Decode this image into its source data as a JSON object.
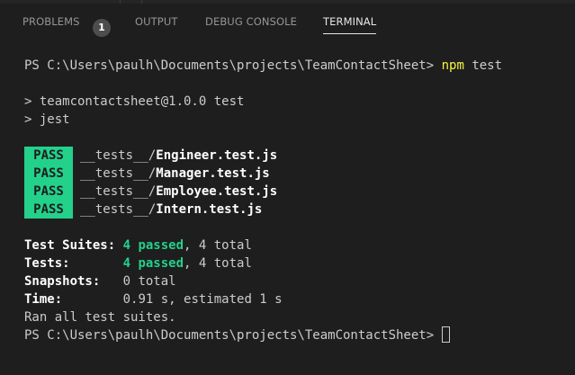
{
  "panel": {
    "tabs": [
      {
        "label": "PROBLEMS",
        "badge": "1"
      },
      {
        "label": "OUTPUT"
      },
      {
        "label": "DEBUG CONSOLE"
      },
      {
        "label": "TERMINAL"
      }
    ],
    "active_tab": "TERMINAL"
  },
  "terminal": {
    "prompt": "PS C:\\Users\\paulh\\Documents\\projects\\TeamContactSheet>",
    "command_name": "npm",
    "command_args": "test",
    "script_header": "> teamcontactsheet@1.0.0 test",
    "script_command": "> jest",
    "results": [
      {
        "status": "PASS",
        "dir": "__tests__/",
        "file": "Engineer.test.js"
      },
      {
        "status": "PASS",
        "dir": "__tests__/",
        "file": "Manager.test.js"
      },
      {
        "status": "PASS",
        "dir": "__tests__/",
        "file": "Employee.test.js"
      },
      {
        "status": "PASS",
        "dir": "__tests__/",
        "file": "Intern.test.js"
      }
    ],
    "summary": {
      "suites_label": "Test Suites:",
      "suites_passed": "4 passed",
      "suites_total": ", 4 total",
      "tests_label": "Tests:",
      "tests_passed": "4 passed",
      "tests_total": ", 4 total",
      "snapshots_label": "Snapshots:",
      "snapshots_value": "0 total",
      "time_label": "Time:",
      "time_value": "0.91 s, estimated 1 s"
    },
    "ran_all": "Ran all test suites."
  },
  "colors": {
    "background": "#1e1e1e",
    "pass_green": "#23d18b",
    "command_yellow": "#f5f543",
    "text": "#cccccc"
  }
}
